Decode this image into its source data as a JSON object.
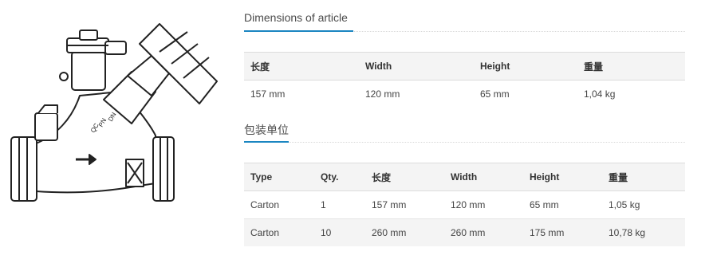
{
  "dimensions": {
    "title": "Dimensions of article",
    "headers": [
      "长度",
      "Width",
      "Height",
      "重量"
    ],
    "row": [
      "157 mm",
      "120 mm",
      "65 mm",
      "1,04 kg"
    ]
  },
  "packaging": {
    "title": "包装单位",
    "headers": [
      "Type",
      "Qty.",
      "长度",
      "Width",
      "Height",
      "重量"
    ],
    "rows": [
      [
        "Carton",
        "1",
        "157 mm",
        "120 mm",
        "65 mm",
        "1,05 kg"
      ],
      [
        "Carton",
        "10",
        "260 mm",
        "260 mm",
        "175 mm",
        "10,78 kg"
      ]
    ]
  },
  "product_image": {
    "body_text": [
      "DN",
      "PN",
      "QC"
    ]
  }
}
